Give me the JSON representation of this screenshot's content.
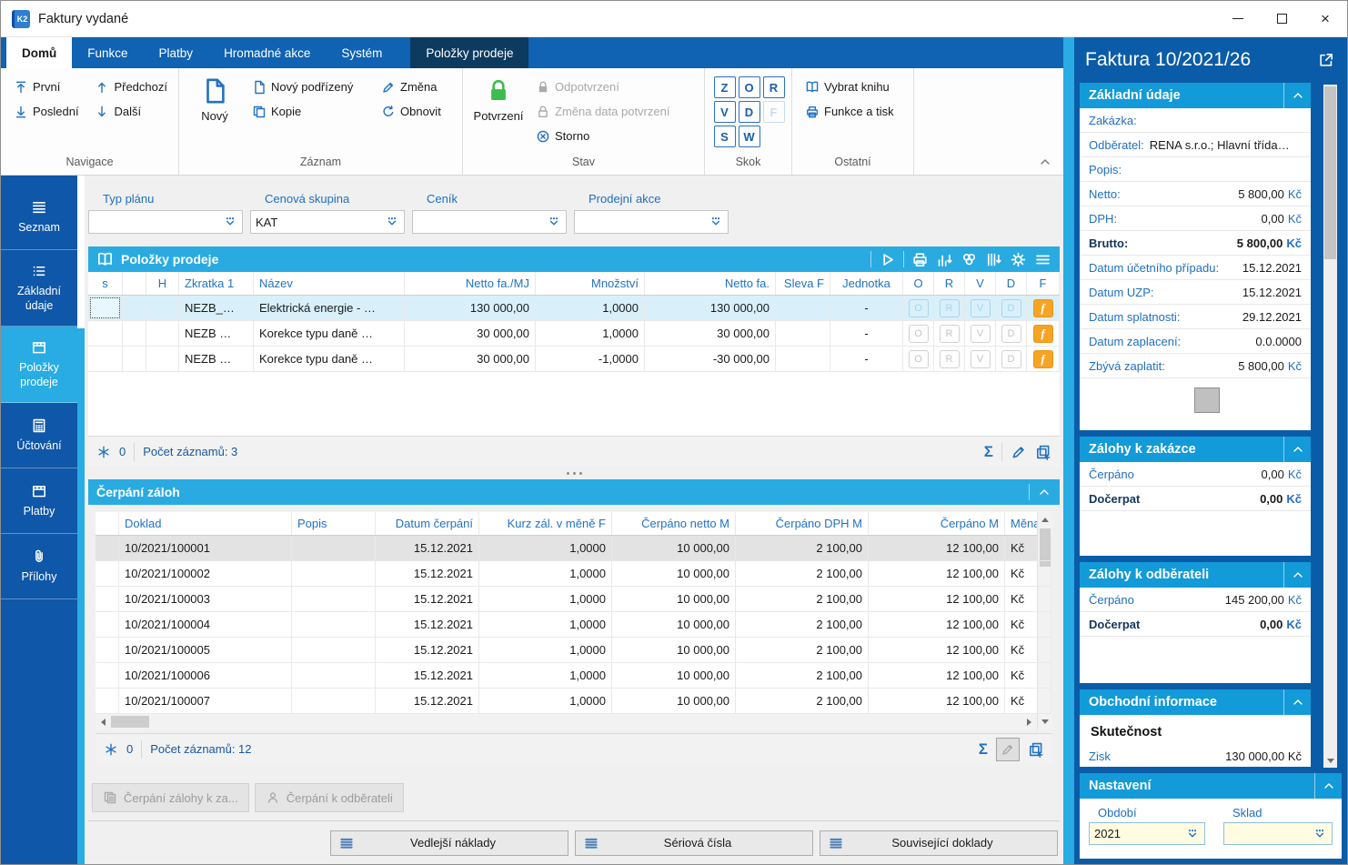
{
  "window": {
    "title": "Faktury vydané"
  },
  "ribbon": {
    "tabs": [
      {
        "label": "Domů",
        "state": "selected"
      },
      {
        "label": "Funkce",
        "state": "normal"
      },
      {
        "label": "Platby",
        "state": "normal"
      },
      {
        "label": "Hromadné akce",
        "state": "normal"
      },
      {
        "label": "Systém",
        "state": "normal"
      },
      {
        "label": "Položky prodeje",
        "state": "contextual"
      }
    ],
    "navigace": {
      "label": "Navigace",
      "first": "První",
      "last": "Poslední",
      "prev": "Předchozí",
      "next": "Další"
    },
    "zaznam": {
      "label": "Záznam",
      "new": "Nový",
      "new_child": "Nový podřízený",
      "copy": "Kopie",
      "change": "Změna",
      "refresh": "Obnovit"
    },
    "stav": {
      "label": "Stav",
      "confirm": "Potvrzení",
      "unconfirm": "Odpotvrzení",
      "change_confirm_date": "Změna data potvrzení",
      "cancel": "Storno"
    },
    "skok": {
      "label": "Skok",
      "letters": [
        {
          "ch": "Z"
        },
        {
          "ch": "O"
        },
        {
          "ch": "R"
        },
        {
          "ch": "V"
        },
        {
          "ch": "D"
        },
        {
          "ch": "F",
          "disabled": true
        },
        {
          "ch": "S"
        },
        {
          "ch": "W"
        }
      ]
    },
    "ostatni": {
      "label": "Ostatní",
      "select_book": "Vybrat knihu",
      "functions_print": "Funkce a tisk"
    }
  },
  "sidebar": {
    "items": [
      {
        "label": "Seznam",
        "icon": "menu4"
      },
      {
        "label": "Základní údaje",
        "icon": "list",
        "two_line": true
      },
      {
        "label": "Položky prodeje",
        "icon": "box",
        "two_line": true,
        "selected": true
      },
      {
        "label": "Účtování",
        "icon": "calculator"
      },
      {
        "label": "Platby",
        "icon": "box"
      },
      {
        "label": "Přílohy",
        "icon": "paperclip"
      }
    ]
  },
  "filters": [
    {
      "label": "Typ plánu",
      "value": ""
    },
    {
      "label": "Cenová skupina",
      "value": "KAT"
    },
    {
      "label": "Ceník",
      "value": ""
    },
    {
      "label": "Prodejní akce",
      "value": ""
    }
  ],
  "items_panel": {
    "title": "Položky prodeje",
    "columns": [
      "s",
      "",
      "H",
      "Zkratka 1",
      "Název",
      "Netto fa./MJ",
      "Množství",
      "Netto fa.",
      "Sleva F",
      "Jednotka",
      "O",
      "R",
      "V",
      "D",
      "F"
    ],
    "flag_letters": [
      "O",
      "R",
      "V",
      "D"
    ],
    "f_flag": "f",
    "rows": [
      {
        "s": "",
        "h": "",
        "zkratka": "NEZB_…",
        "nazev": "Elektrická energie - …",
        "netto_mj": "130 000,00",
        "mnozstvi": "1,0000",
        "netto": "130 000,00",
        "sleva": "",
        "jednotka": "-",
        "selected": true
      },
      {
        "s": "",
        "h": "",
        "zkratka": "NEZB …",
        "nazev": "Korekce typu daně …",
        "netto_mj": "30 000,00",
        "mnozstvi": "1,0000",
        "netto": "30 000,00",
        "sleva": "",
        "jednotka": "-"
      },
      {
        "s": "",
        "h": "",
        "zkratka": "NEZB …",
        "nazev": "Korekce typu daně …",
        "netto_mj": "30 000,00",
        "mnozstvi": "-1,0000",
        "netto": "-30 000,00",
        "sleva": "",
        "jednotka": "-"
      }
    ],
    "status": {
      "flag_count": "0",
      "records": "Počet záznamů: 3"
    }
  },
  "advances_panel": {
    "title": "Čerpání záloh",
    "columns": [
      "Doklad",
      "Popis",
      "Datum čerpání",
      "Kurz zál. v měně F",
      "Čerpáno netto M",
      "Čerpáno DPH M",
      "Čerpáno M",
      "Měna"
    ],
    "rows": [
      {
        "doklad": "10/2021/100001",
        "popis": "",
        "datum": "15.12.2021",
        "kurz": "1,0000",
        "netto": "10 000,00",
        "dph": "2 100,00",
        "cerpano": "12 100,00",
        "mena": "Kč",
        "selected": true
      },
      {
        "doklad": "10/2021/100002",
        "popis": "",
        "datum": "15.12.2021",
        "kurz": "1,0000",
        "netto": "10 000,00",
        "dph": "2 100,00",
        "cerpano": "12 100,00",
        "mena": "Kč"
      },
      {
        "doklad": "10/2021/100003",
        "popis": "",
        "datum": "15.12.2021",
        "kurz": "1,0000",
        "netto": "10 000,00",
        "dph": "2 100,00",
        "cerpano": "12 100,00",
        "mena": "Kč"
      },
      {
        "doklad": "10/2021/100004",
        "popis": "",
        "datum": "15.12.2021",
        "kurz": "1,0000",
        "netto": "10 000,00",
        "dph": "2 100,00",
        "cerpano": "12 100,00",
        "mena": "Kč"
      },
      {
        "doklad": "10/2021/100005",
        "popis": "",
        "datum": "15.12.2021",
        "kurz": "1,0000",
        "netto": "10 000,00",
        "dph": "2 100,00",
        "cerpano": "12 100,00",
        "mena": "Kč"
      },
      {
        "doklad": "10/2021/100006",
        "popis": "",
        "datum": "15.12.2021",
        "kurz": "1,0000",
        "netto": "10 000,00",
        "dph": "2 100,00",
        "cerpano": "12 100,00",
        "mena": "Kč"
      },
      {
        "doklad": "10/2021/100007",
        "popis": "",
        "datum": "15.12.2021",
        "kurz": "1,0000",
        "netto": "10 000,00",
        "dph": "2 100,00",
        "cerpano": "12 100,00",
        "mena": "Kč"
      }
    ],
    "status": {
      "flag_count": "0",
      "records": "Počet záznamů: 12"
    }
  },
  "footer": {
    "secondary_buttons": [
      {
        "label": "Čerpání zálohy k za...",
        "icon": "doccopy",
        "disabled": true
      },
      {
        "label": "Čerpání k odběrateli",
        "icon": "person",
        "disabled": true
      }
    ],
    "buttons": [
      {
        "label": "Vedlejší náklady"
      },
      {
        "label": "Sériová čísla"
      },
      {
        "label": "Související doklady"
      }
    ]
  },
  "detail": {
    "title": "Faktura 10/2021/26",
    "basic": {
      "header": "Základní údaje",
      "rows": [
        {
          "label": "Zakázka:",
          "value": ""
        },
        {
          "label": "Odběratel:",
          "value": "RENA s.r.o.; Hlavní třída…",
          "value_left": true
        },
        {
          "label": "Popis:",
          "value": ""
        },
        {
          "label": "Netto:",
          "value": "5 800,00",
          "unit": "Kč"
        },
        {
          "label": "DPH:",
          "value": "0,00",
          "unit": "Kč"
        },
        {
          "label": "Brutto:",
          "value": "5 800,00",
          "unit": "Kč",
          "bold": true
        },
        {
          "label": "Datum účetního případu:",
          "value": "15.12.2021"
        },
        {
          "label": "Datum UZP:",
          "value": "15.12.2021"
        },
        {
          "label": "Datum splatnosti:",
          "value": "29.12.2021"
        },
        {
          "label": "Datum zaplacení:",
          "value": "0.0.0000"
        },
        {
          "label": "Zbývá zaplatit:",
          "value": "5 800,00",
          "unit": "Kč"
        }
      ]
    },
    "advances_order": {
      "header": "Zálohy k zakázce",
      "rows": [
        {
          "label": "Čerpáno",
          "value": "0,00",
          "unit": "Kč"
        },
        {
          "label": "Dočerpat",
          "value": "0,00",
          "unit": "Kč",
          "bold": true
        }
      ]
    },
    "advances_customer": {
      "header": "Zálohy k odběrateli",
      "rows": [
        {
          "label": "Čerpáno",
          "value": "145 200,00",
          "unit": "Kč"
        },
        {
          "label": "Dočerpat",
          "value": "0,00",
          "unit": "Kč",
          "bold": true
        }
      ]
    },
    "business": {
      "header": "Obchodní informace",
      "subheader": "Skutečnost",
      "clipped_row": {
        "label": "Zisk",
        "value": "130 000,00 Kč"
      }
    },
    "settings": {
      "header": "Nastavení",
      "fields": [
        {
          "label": "Období",
          "value": "2021"
        },
        {
          "label": "Sklad",
          "value": ""
        }
      ]
    }
  },
  "colors": {
    "accent_cyan": "#29abe2",
    "section_header_blue": "#139ad8",
    "ribbon_blue": "#1062b2",
    "panel_blue": "#0b5ca8",
    "link_blue": "#1f6fc0",
    "flag_orange": "#f7a425",
    "confirm_green": "#3cbc4c",
    "selected_row": "#d9f0fb"
  }
}
